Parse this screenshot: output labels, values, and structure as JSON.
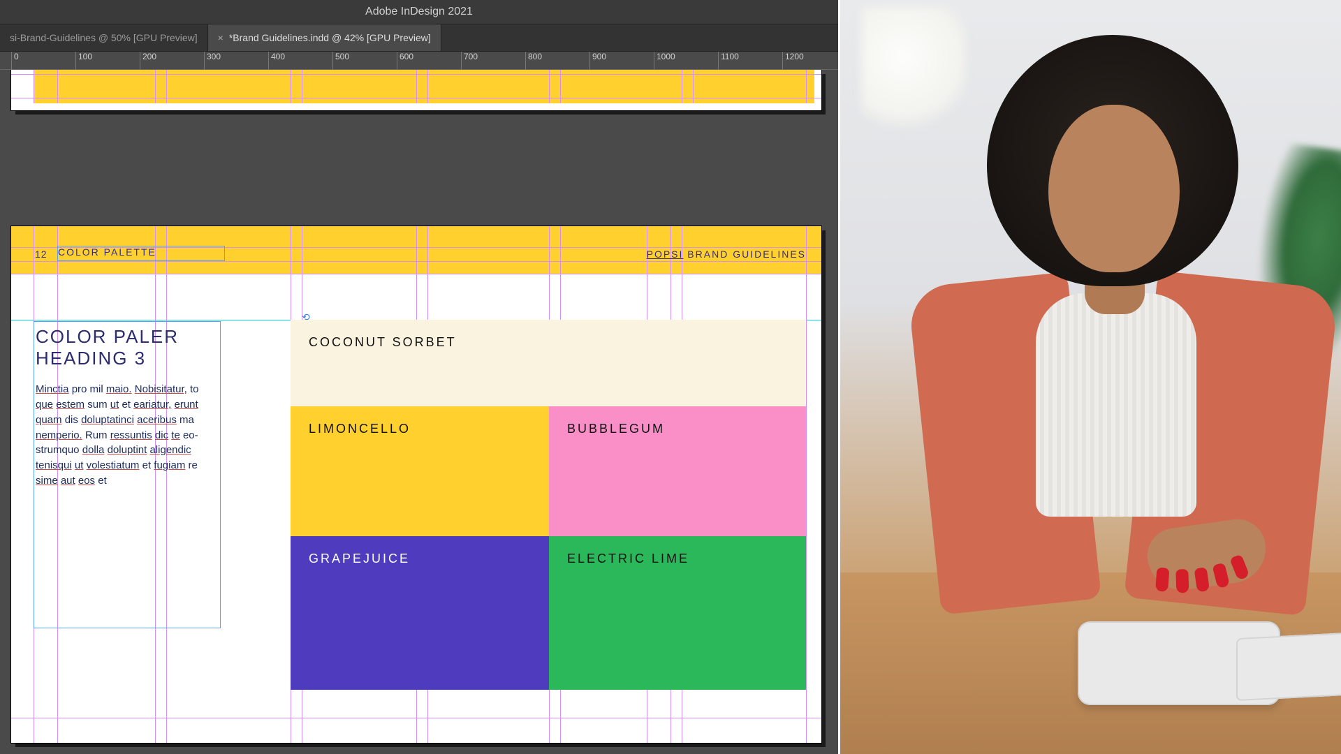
{
  "app_title": "Adobe InDesign 2021",
  "tabs": [
    {
      "label": "si-Brand-Guidelines @ 50% [GPU Preview]",
      "active": false
    },
    {
      "label": "*Brand Guidelines.indd @ 42% [GPU Preview]",
      "active": true
    }
  ],
  "ruler_ticks": [
    "0",
    "100",
    "200",
    "300",
    "400",
    "500",
    "600",
    "700",
    "800",
    "900",
    "1000",
    "1100",
    "1200"
  ],
  "page": {
    "number": "12",
    "section": "COLOR PALETTE",
    "brand_prefix": "POPSI",
    "brand_suffix": " BRAND GUIDELINES",
    "heading": "COLOR PALER HEADING 3",
    "body_html": "Minctia pro mil maio. Nobisitatur, to que estem sum ut et eariatur, erunt quam dis doluptatinci aceribus ma nemperio. Rum ressuntis dic te eo-strumquo dolla doluptint aligendic tenisqui ut volestiatum et fugiam re sime aut eos et",
    "body_underlined": [
      "Minctia",
      "maio",
      "Nobisitatur",
      "que",
      "estem",
      "ut",
      "eariatur",
      "erunt",
      "quam",
      "doluptatinci",
      "aceribus",
      "nemperio",
      "ressuntis",
      "dic",
      "te",
      "eo",
      "strumquo",
      "dolla",
      "doluptint",
      "aligendic",
      "tenisqui",
      "ut",
      "volestiatum",
      "fugiam",
      "sime",
      "aut",
      "eos"
    ]
  },
  "swatches": [
    {
      "name": "COCONUT SORBET",
      "hex": "#f9f3df",
      "text": "dark",
      "col": "full",
      "row": 0
    },
    {
      "name": "LIMONCELLO",
      "hex": "#ffd02e",
      "text": "dark",
      "col": "left",
      "row": 1
    },
    {
      "name": "BUBBLEGUM",
      "hex": "#f98fc6",
      "text": "dark",
      "col": "right",
      "row": 1
    },
    {
      "name": "GRAPEJUICE",
      "hex": "#4f3bbd",
      "text": "light",
      "col": "left",
      "row": 2
    },
    {
      "name": "ELECTRIC LIME",
      "hex": "#2bb85a",
      "text": "dark",
      "col": "right",
      "row": 2
    }
  ],
  "colors": {
    "guide_pink": "#d48fff",
    "guide_cyan": "#00d6e6",
    "frame_blue": "#5aa0ff",
    "ui_bg": "#4a4a4a",
    "yellow": "#ffd02e"
  }
}
